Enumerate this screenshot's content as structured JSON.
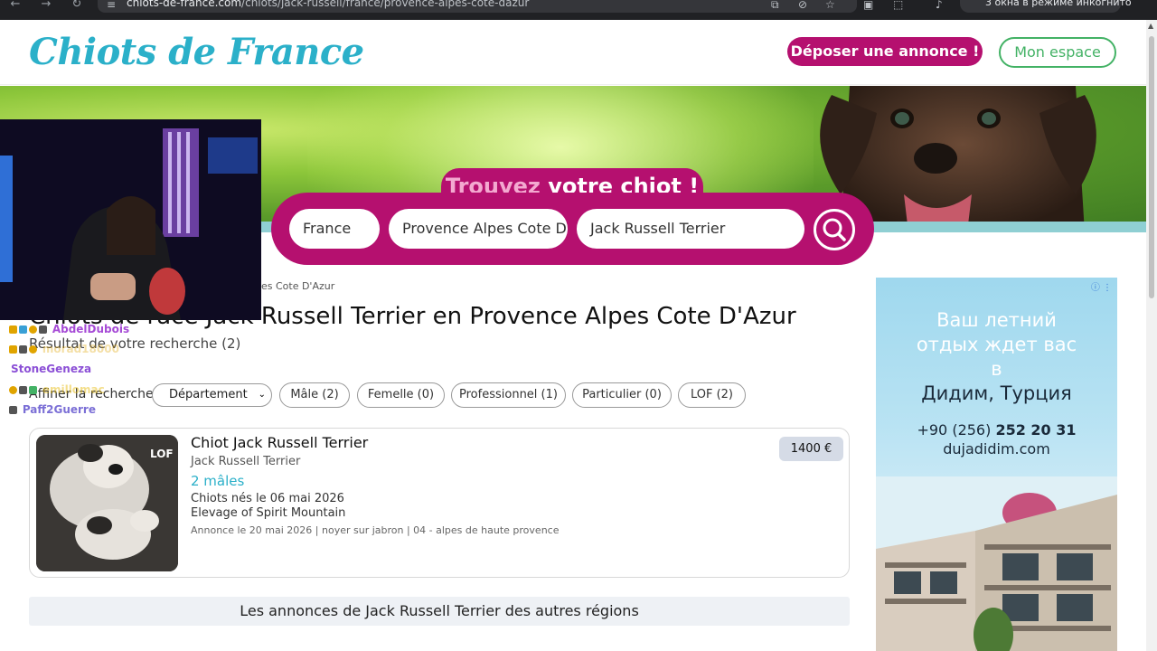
{
  "browser": {
    "url_domain": "chiots-de-france.com",
    "url_path": "/chiots/jack-russell/france/provence-alpes-cote-dazur",
    "incognito_label": "3 окна в режиме инкогнито"
  },
  "header": {
    "logo": "Chiots de France",
    "deposit_button": "Déposer une annonce !",
    "account_button": "Mon espace"
  },
  "search": {
    "tab_light": "Trouvez",
    "tab_bold": "votre chiot !",
    "country": "France",
    "region": "Provence Alpes Cote D",
    "breed": "Jack Russell Terrier"
  },
  "main": {
    "breadcrumb": "pes Cote D'Azur",
    "title": "Chiots de race Jack Russell Terrier en Provence Alpes Cote D'Azur",
    "result_count": "Résultat de votre recherche (2)",
    "refine_label": "Affiner la recherche",
    "department_select": "Département",
    "filters": [
      "Mâle (2)",
      "Femelle (0)",
      "Professionnel (1)",
      "Particulier (0)",
      "LOF (2)"
    ]
  },
  "listing": {
    "badge": "LOF",
    "title": "Chiot Jack Russell Terrier",
    "breed": "Jack Russell Terrier",
    "males": "2 mâles",
    "born": "Chiots nés le 06 mai 2026",
    "kennel": "Elevage of Spirit Mountain",
    "meta": "Annonce le 20 mai 2026 | noyer sur jabron | 04 - alpes de haute provence",
    "price": "1400 €"
  },
  "other_regions": "Les annonces de Jack Russell Terrier des autres régions",
  "ad": {
    "line1": "Ваш летний",
    "line2": "отдых ждет вас",
    "line3": "в",
    "line4": "Дидим, Турция",
    "phone_prefix": "+90 (256)",
    "phone_number": "252 20 31",
    "domain": "dujadidim.com"
  },
  "chat": [
    {
      "user": "AbdelDubois",
      "color": "#a64bd6"
    },
    {
      "user": "morad18000",
      "color": "#e0a400"
    },
    {
      "user": "StoneGeneza",
      "color": "#8b4fd6"
    },
    {
      "user": "emillomac",
      "color": "#e6b800"
    },
    {
      "user": "Paff2Guerre",
      "color": "#7b6fd6"
    }
  ]
}
